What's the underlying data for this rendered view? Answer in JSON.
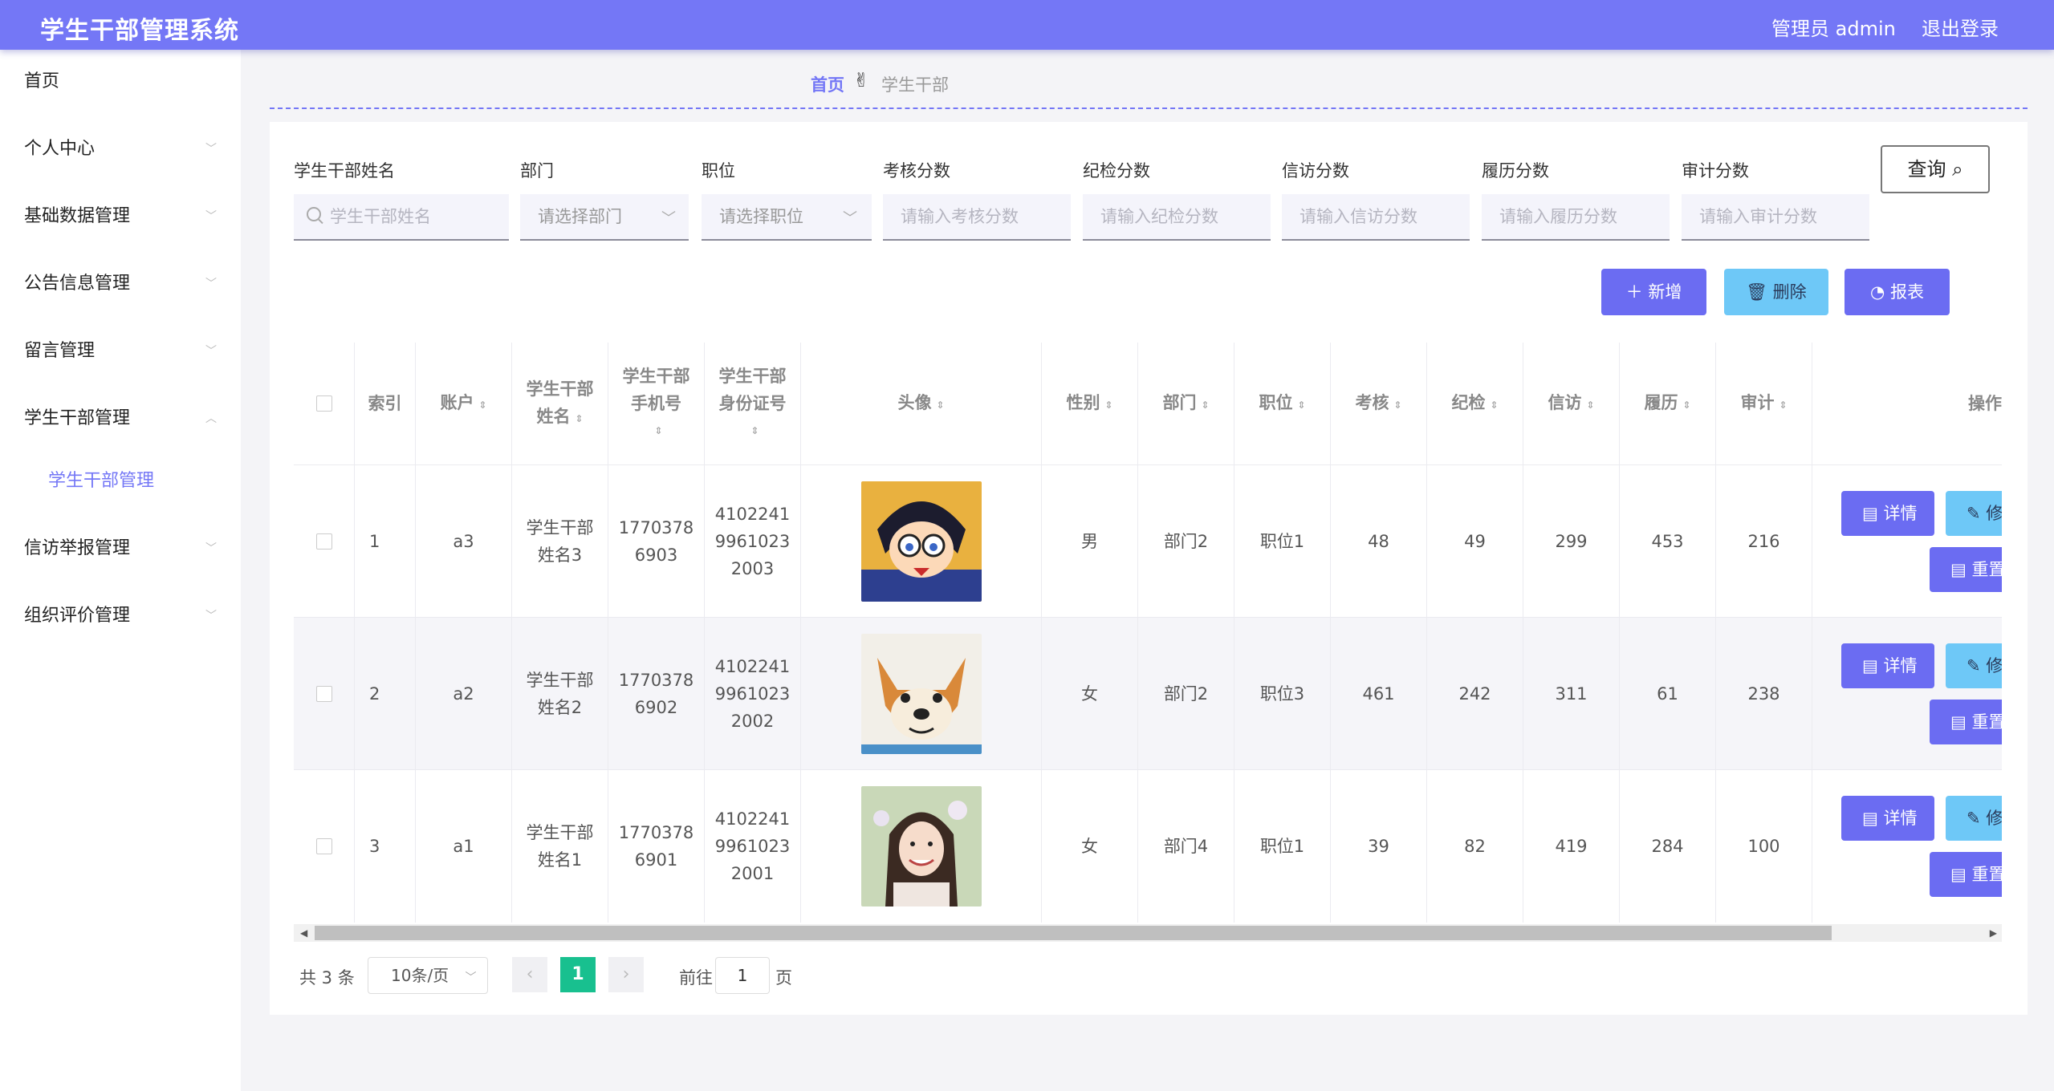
{
  "header": {
    "title": "学生干部管理系统",
    "admin": "管理员 admin",
    "logout": "退出登录"
  },
  "sidebar": {
    "items": [
      {
        "label": "首页",
        "chev": ""
      },
      {
        "label": "个人中心",
        "chev": "﹀"
      },
      {
        "label": "基础数据管理",
        "chev": "﹀"
      },
      {
        "label": "公告信息管理",
        "chev": "﹀"
      },
      {
        "label": "留言管理",
        "chev": "﹀"
      },
      {
        "label": "学生干部管理",
        "chev": "︿"
      },
      {
        "label": "学生干部管理",
        "chev": ""
      },
      {
        "label": "信访举报管理",
        "chev": "﹀"
      },
      {
        "label": "组织评价管理",
        "chev": "﹀"
      }
    ]
  },
  "breadcrumb": {
    "home": "首页",
    "sep": "✌",
    "current": "学生干部"
  },
  "filters": {
    "name": {
      "label": "学生干部姓名",
      "placeholder": "学生干部姓名"
    },
    "dept": {
      "label": "部门",
      "placeholder": "请选择部门"
    },
    "post": {
      "label": "职位",
      "placeholder": "请选择职位"
    },
    "kaohe": {
      "label": "考核分数",
      "placeholder": "请输入考核分数"
    },
    "jijian": {
      "label": "纪检分数",
      "placeholder": "请输入纪检分数"
    },
    "xinfang": {
      "label": "信访分数",
      "placeholder": "请输入信访分数"
    },
    "lvli": {
      "label": "履历分数",
      "placeholder": "请输入履历分数"
    },
    "shenji": {
      "label": "审计分数",
      "placeholder": "请输入审计分数"
    }
  },
  "buttons": {
    "query": "查询",
    "add": "新增",
    "del": "删除",
    "report": "报表"
  },
  "table": {
    "headers": {
      "index": "索引",
      "account": "账户",
      "name1": "学生干部",
      "name2": "姓名",
      "phone1": "学生干部",
      "phone2": "手机号",
      "id1": "学生干部",
      "id2": "身份证号",
      "avatar": "头像",
      "gender": "性别",
      "dept": "部门",
      "post": "职位",
      "kaohe": "考核",
      "jijian": "纪检",
      "xinfang": "信访",
      "lvli": "履历",
      "shenji": "审计",
      "ops": "操作"
    },
    "rows": [
      {
        "index": "1",
        "account": "a3",
        "name1": "学生干部",
        "name2": "姓名3",
        "phone1": "1770378",
        "phone2": "6903",
        "id1": "4102241",
        "id2": "9961023",
        "id3": "2003",
        "gender": "男",
        "dept": "部门2",
        "post": "职位1",
        "kaohe": "48",
        "jijian": "49",
        "xinfang": "299",
        "lvli": "453",
        "shenji": "216"
      },
      {
        "index": "2",
        "account": "a2",
        "name1": "学生干部",
        "name2": "姓名2",
        "phone1": "1770378",
        "phone2": "6902",
        "id1": "4102241",
        "id2": "9961023",
        "id3": "2002",
        "gender": "女",
        "dept": "部门2",
        "post": "职位3",
        "kaohe": "461",
        "jijian": "242",
        "xinfang": "311",
        "lvli": "61",
        "shenji": "238"
      },
      {
        "index": "3",
        "account": "a1",
        "name1": "学生干部",
        "name2": "姓名1",
        "phone1": "1770378",
        "phone2": "6901",
        "id1": "4102241",
        "id2": "9961023",
        "id3": "2001",
        "gender": "女",
        "dept": "部门4",
        "post": "职位1",
        "kaohe": "39",
        "jijian": "82",
        "xinfang": "419",
        "lvli": "284",
        "shenji": "100"
      }
    ],
    "op_labels": {
      "detail": "详情",
      "edit": "修",
      "reset": "重置"
    }
  },
  "pagination": {
    "total": "共 3 条",
    "size": "10条/页",
    "current": "1",
    "goto": "前往",
    "goto_value": "1",
    "page": "页"
  },
  "colors": {
    "primary": "#7477f6",
    "cyan": "#6ec8f7",
    "pager": "#18c08f"
  }
}
